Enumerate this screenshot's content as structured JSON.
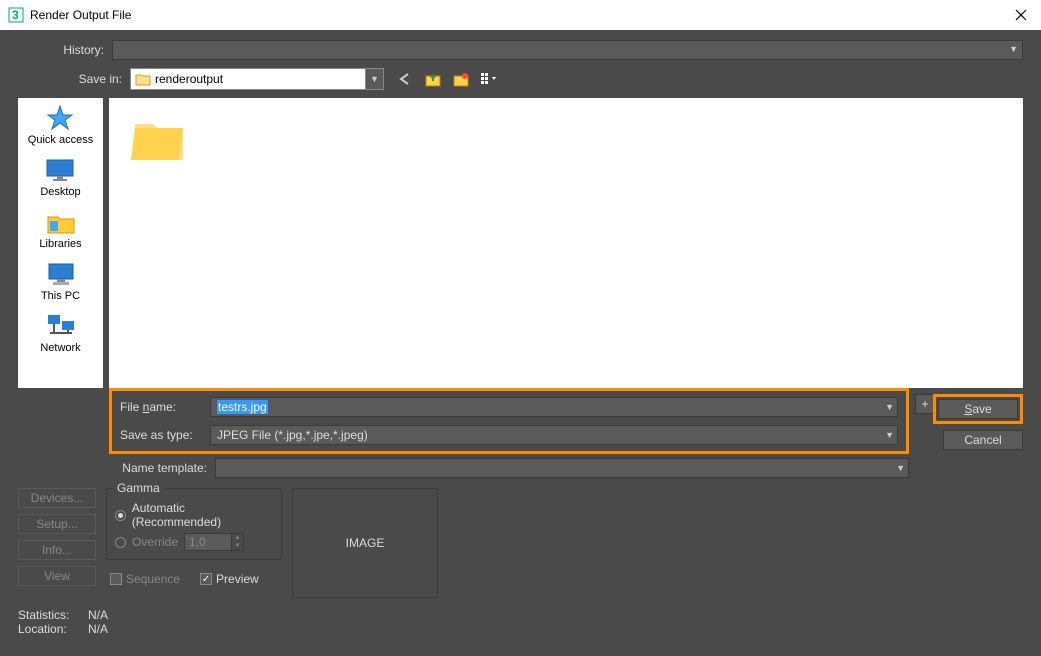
{
  "window": {
    "title": "Render Output File"
  },
  "history": {
    "label": "History:"
  },
  "savein": {
    "label": "Save in:",
    "value": "renderoutput"
  },
  "places": {
    "quick_access": "Quick access",
    "desktop": "Desktop",
    "libraries": "Libraries",
    "this_pc": "This PC",
    "network": "Network"
  },
  "file_item": {
    "name": ""
  },
  "form": {
    "filename_label": "File name:",
    "filename_value": "testrs.jpg",
    "saveas_label": "Save as type:",
    "saveas_value": "JPEG File (*.jpg,*.jpe,*.jpeg)",
    "template_label": "Name template:",
    "plus": "+",
    "save": "Save",
    "cancel": "Cancel"
  },
  "left_buttons": {
    "devices": "Devices...",
    "setup": "Setup...",
    "info": "Info...",
    "view": "View"
  },
  "gamma": {
    "legend": "Gamma",
    "automatic": "Automatic (Recommended)",
    "override": "Override",
    "override_value": "1,0",
    "sequence": "Sequence",
    "preview": "Preview"
  },
  "image_box": "IMAGE",
  "status": {
    "statistics_label": "Statistics:",
    "statistics_value": "N/A",
    "location_label": "Location:",
    "location_value": "N/A"
  }
}
